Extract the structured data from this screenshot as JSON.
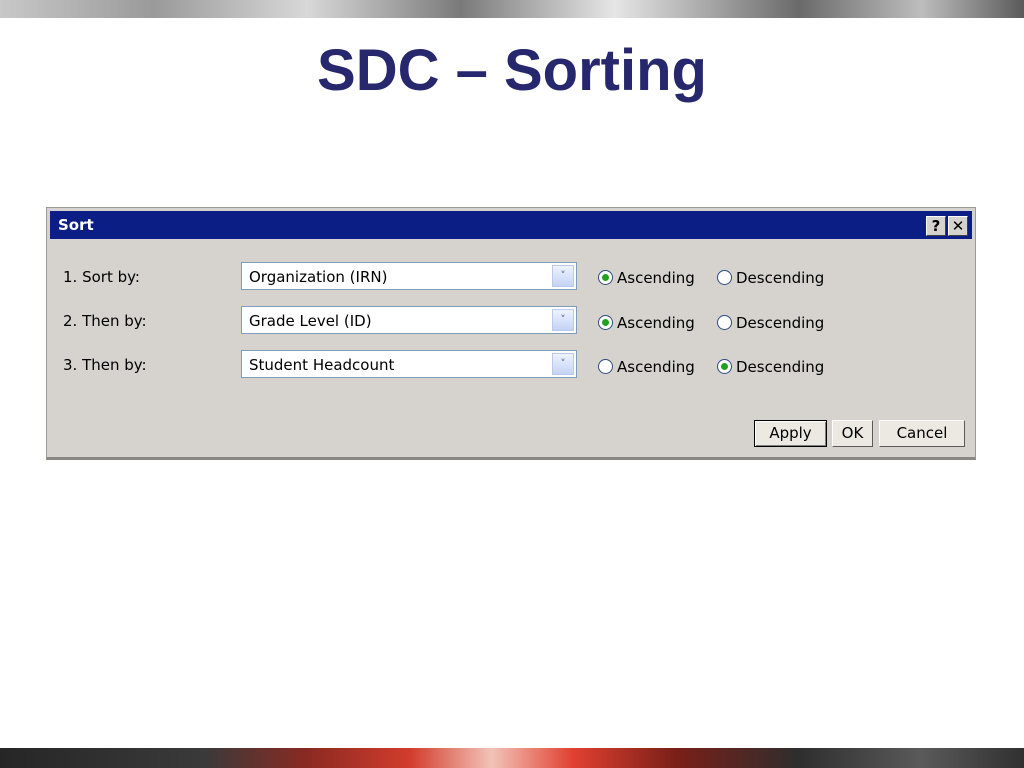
{
  "slide": {
    "title": "SDC – Sorting"
  },
  "dialog": {
    "title": "Sort",
    "help_label": "?",
    "close_label": "✕",
    "rows": [
      {
        "label": "1. Sort by:",
        "field": "Organization (IRN)",
        "asc_label": "Ascending",
        "desc_label": "Descending",
        "order": "ascending"
      },
      {
        "label": "2. Then by:",
        "field": "Grade Level (ID)",
        "asc_label": "Ascending",
        "desc_label": "Descending",
        "order": "ascending"
      },
      {
        "label": "3. Then by:",
        "field": "Student Headcount",
        "asc_label": "Ascending",
        "desc_label": "Descending",
        "order": "descending"
      }
    ],
    "buttons": {
      "apply": "Apply",
      "ok": "OK",
      "cancel": "Cancel"
    },
    "dropdown_icon": "chevron-down-icon"
  },
  "colors": {
    "title_text": "#27276e",
    "titlebar": "#0a1e86",
    "dialog_bg": "#d6d3ce",
    "radio_dot": "#21a121"
  }
}
